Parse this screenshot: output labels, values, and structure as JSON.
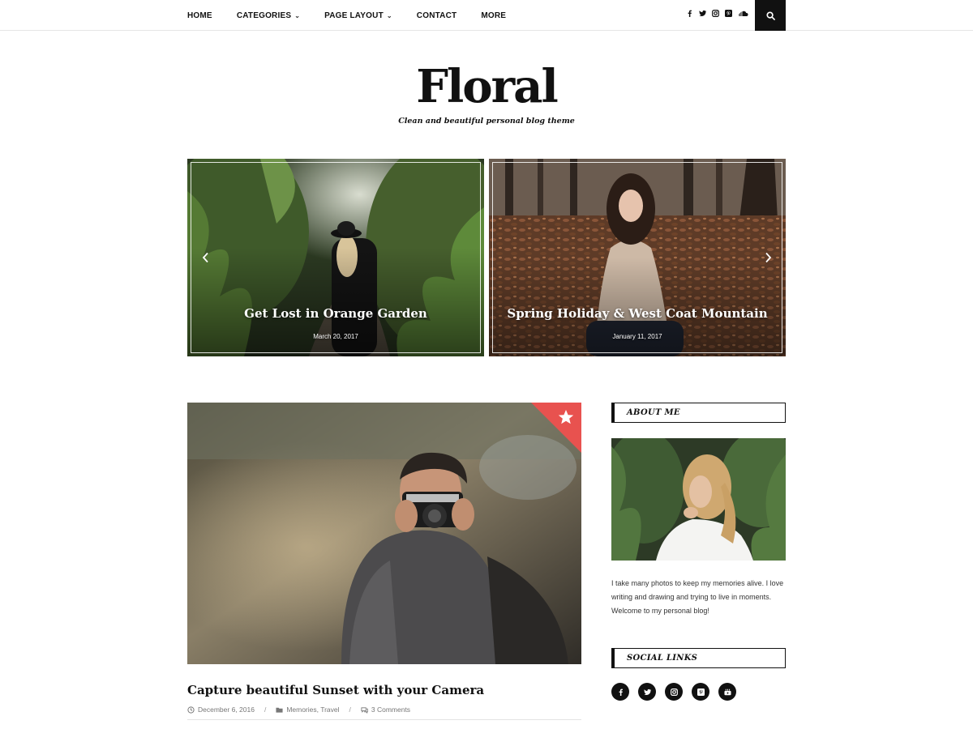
{
  "nav": {
    "items": [
      {
        "label": "HOME",
        "has_dropdown": false
      },
      {
        "label": "CATEGORIES",
        "has_dropdown": true
      },
      {
        "label": "PAGE LAYOUT",
        "has_dropdown": true
      },
      {
        "label": "CONTACT",
        "has_dropdown": false
      },
      {
        "label": "MORE",
        "has_dropdown": false
      }
    ],
    "social_icons": [
      "facebook-icon",
      "twitter-icon",
      "instagram-icon",
      "pinterest-icon",
      "soundcloud-icon"
    ],
    "search_icon": "search-icon"
  },
  "site": {
    "logo": "Floral",
    "tagline": "Clean and beautiful personal blog theme"
  },
  "slider": {
    "slides": [
      {
        "title": "Get Lost in Orange Garden",
        "date": "March 20, 2017"
      },
      {
        "title": "Spring Holiday & West Coat Mountain",
        "date": "January 11, 2017"
      }
    ],
    "prev_icon": "chevron-left-icon",
    "next_icon": "chevron-right-icon"
  },
  "post": {
    "title": "Capture beautiful Sunset with your Camera",
    "date": "December 6, 2016",
    "categories": "Memories, Travel",
    "comments": "3 Comments",
    "separator": "/",
    "featured_icon": "star-icon"
  },
  "sidebar": {
    "about_heading": "ABOUT ME",
    "about_text": "I take many photos to keep my memories alive. I love writing and drawing and trying to live in moments. Welcome to my personal blog!",
    "social_heading": "SOCIAL LINKS",
    "social_icons": [
      "facebook-icon",
      "twitter-icon",
      "instagram-icon",
      "pinterest-icon",
      "youtube-icon"
    ]
  },
  "colors": {
    "accent": "#e8524f",
    "dark": "#111111",
    "meta": "#777777"
  }
}
